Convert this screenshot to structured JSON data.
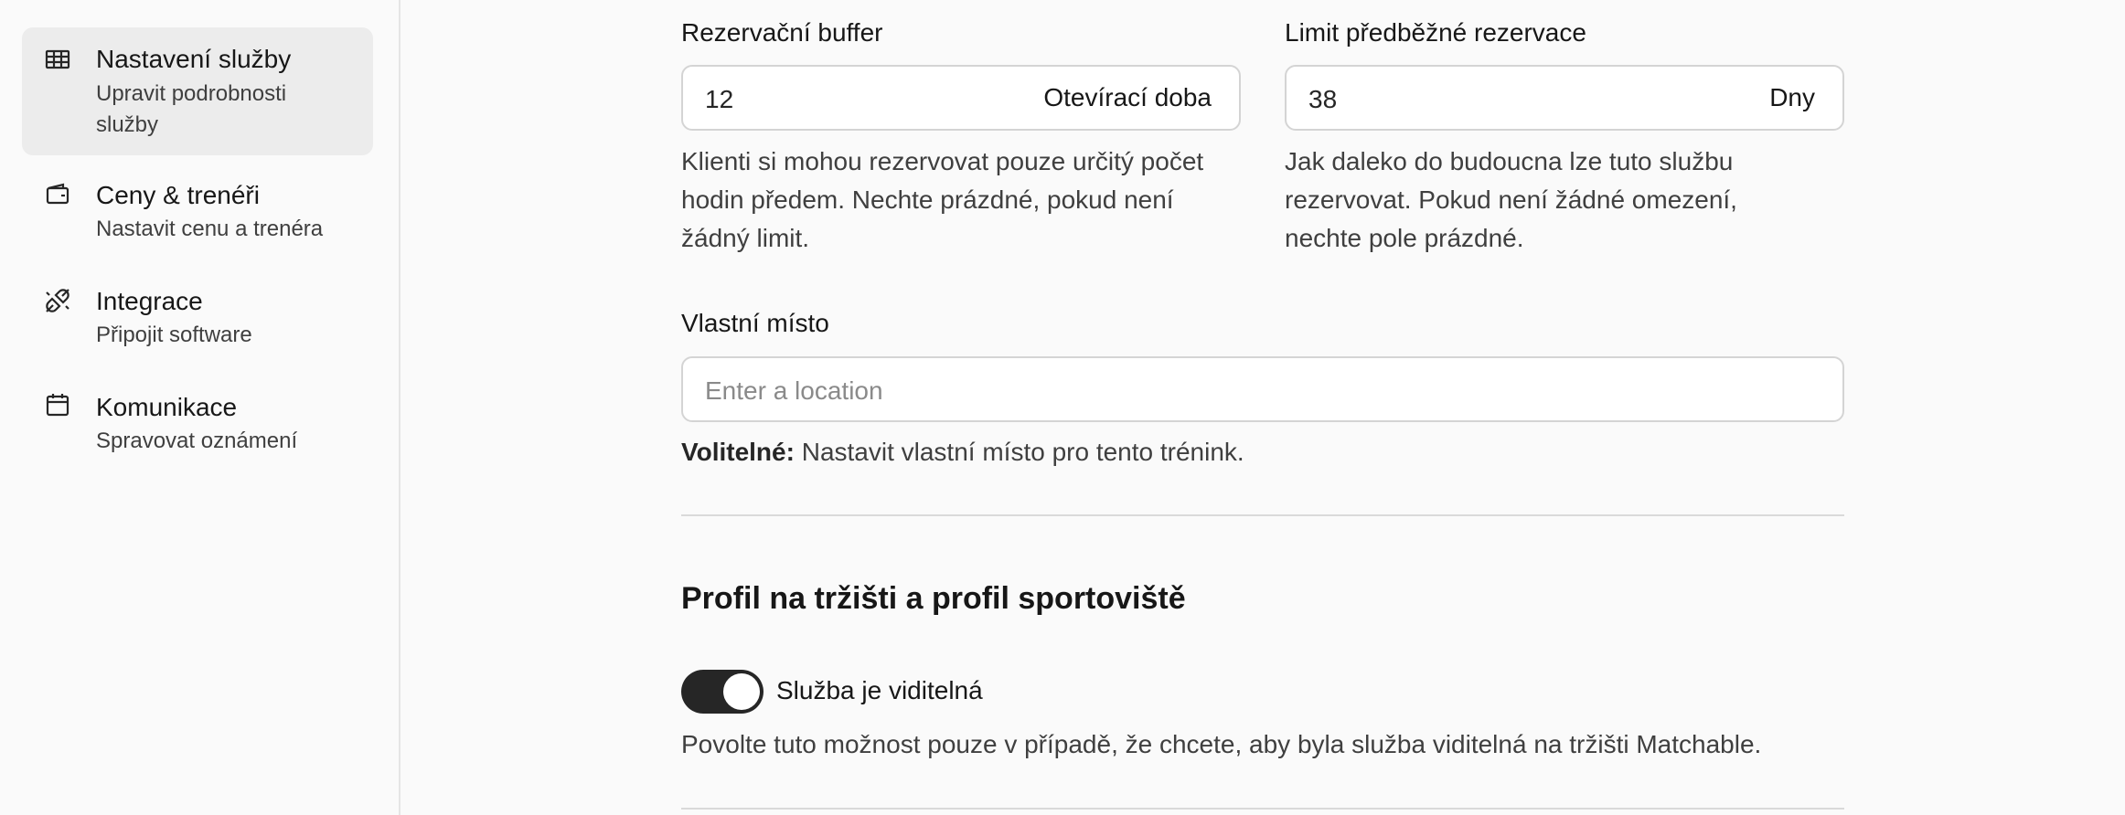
{
  "sidebar": {
    "items": [
      {
        "icon": "table-icon",
        "title": "Nastavení služby",
        "subtitle": "Upravit podrobnosti služby",
        "active": true
      },
      {
        "icon": "wallet-icon",
        "title": "Ceny & trenéři",
        "subtitle": "Nastavit cenu a trenéra",
        "active": false
      },
      {
        "icon": "plug-disconnected-icon",
        "title": "Integrace",
        "subtitle": "Připojit software",
        "active": false
      },
      {
        "icon": "calendar-icon",
        "title": "Komunikace",
        "subtitle": "Spravovat oznámení",
        "active": false
      }
    ]
  },
  "form": {
    "booking_buffer": {
      "label": "Rezervační buffer",
      "value": "12",
      "unit": "Otevírací doba",
      "help": "Klienti si mohou rezervovat pouze určitý počet hodin předem. Nechte prázdné, pokud není žádný limit."
    },
    "advance_limit": {
      "label": "Limit předběžné rezervace",
      "value": "38",
      "unit": "Dny",
      "help": "Jak daleko do budoucna lze tuto službu rezervovat. Pokud není žádné omezení, nechte pole prázdné."
    },
    "custom_location": {
      "label": "Vlastní místo",
      "placeholder": "Enter a location",
      "help_strong": "Volitelné:",
      "help": " Nastavit vlastní místo pro tento trénink."
    }
  },
  "marketplace": {
    "title": "Profil na tržišti a profil sportoviště",
    "toggle_label": "Služba je viditelná",
    "toggle_on": true,
    "help": "Povolte tuto možnost pouze v případě, že chcete, aby byla služba viditelná na tržišti Matchable."
  }
}
